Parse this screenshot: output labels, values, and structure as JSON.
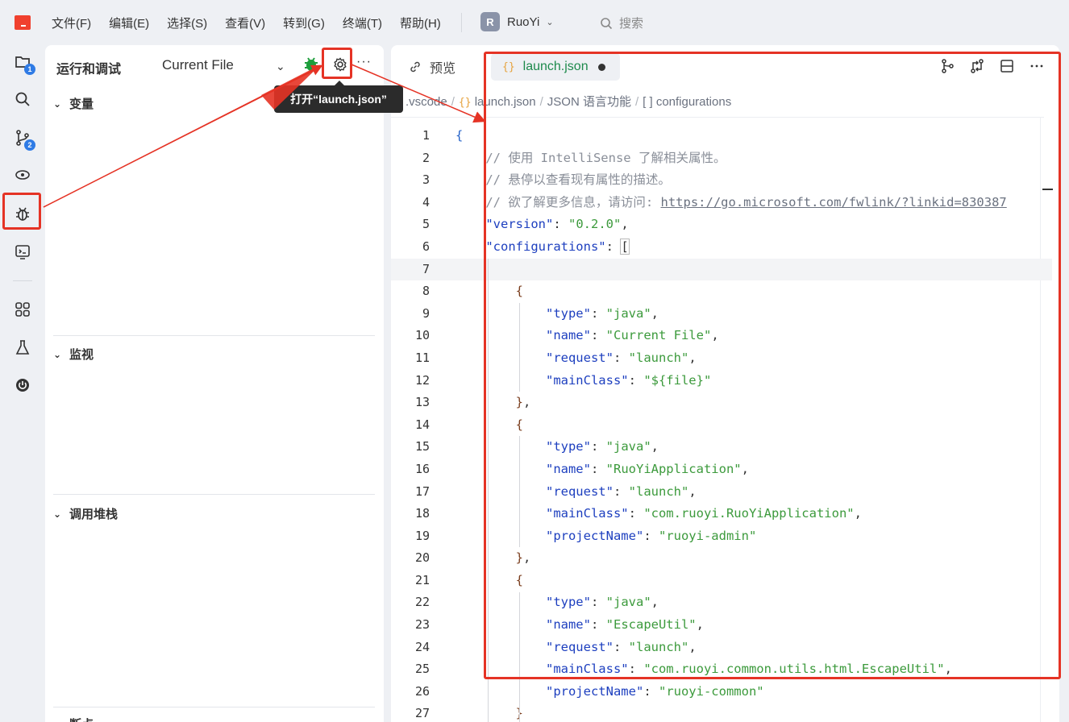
{
  "menu": [
    "文件(F)",
    "编辑(E)",
    "选择(S)",
    "查看(V)",
    "转到(G)",
    "终端(T)",
    "帮助(H)"
  ],
  "workspace": {
    "initial": "R",
    "name": "RuoYi"
  },
  "search": {
    "label": "搜索"
  },
  "activity": {
    "explorer_badge": "1",
    "scm_badge": "2"
  },
  "side": {
    "title": "运行和调试",
    "config": "Current File",
    "more": "···",
    "sections": [
      "变量",
      "监视",
      "调用堆栈",
      "断点"
    ],
    "tooltip": "打开“launch.json”"
  },
  "editor": {
    "tabs": {
      "preview": "预览",
      "active": "launch.json",
      "braces": "{}"
    },
    "breadcrumb": {
      "folder": ".vscode",
      "file": "launch.json",
      "lang": "JSON 语言功能",
      "node": "configurations",
      "node_icon": "[ ]"
    },
    "actions": [
      "source-control-icon",
      "compare-icon",
      "split-editor-icon",
      "more-icon"
    ],
    "lines": [
      {
        "n": "1",
        "html": "<span class='tok-brace'>{</span>"
      },
      {
        "n": "2",
        "html": "    <span class='tok-comment'>// 使用 IntelliSense 了解相关属性。</span>"
      },
      {
        "n": "3",
        "html": "    <span class='tok-comment'>// 悬停以查看现有属性的描述。</span>"
      },
      {
        "n": "4",
        "html": "    <span class='tok-comment'>// 欲了解更多信息，请访问: </span><span class='tok-link'>https://go.microsoft.com/fwlink/?linkid=830387</span>"
      },
      {
        "n": "5",
        "html": "    <span class='tok-key'>\"version\"</span><span class='tok-punc'>: </span><span class='tok-str'>\"0.2.0\"</span><span class='tok-punc'>,</span>"
      },
      {
        "n": "6",
        "html": "    <span class='tok-key'>\"configurations\"</span><span class='tok-punc'>: </span><span class='tok-bracket'>[</span>"
      },
      {
        "n": "7",
        "html": ""
      },
      {
        "n": "8",
        "html": "        <span class='tok-brace2'>{</span>"
      },
      {
        "n": "9",
        "html": "            <span class='tok-key'>\"type\"</span><span class='tok-punc'>: </span><span class='tok-str'>\"java\"</span><span class='tok-punc'>,</span>"
      },
      {
        "n": "10",
        "html": "            <span class='tok-key'>\"name\"</span><span class='tok-punc'>: </span><span class='tok-str'>\"Current File\"</span><span class='tok-punc'>,</span>"
      },
      {
        "n": "11",
        "html": "            <span class='tok-key'>\"request\"</span><span class='tok-punc'>: </span><span class='tok-str'>\"launch\"</span><span class='tok-punc'>,</span>"
      },
      {
        "n": "12",
        "html": "            <span class='tok-key'>\"mainClass\"</span><span class='tok-punc'>: </span><span class='tok-str'>\"${file}\"</span>"
      },
      {
        "n": "13",
        "html": "        <span class='tok-brace2'>}</span><span class='tok-punc'>,</span>"
      },
      {
        "n": "14",
        "html": "        <span class='tok-brace2'>{</span>"
      },
      {
        "n": "15",
        "html": "            <span class='tok-key'>\"type\"</span><span class='tok-punc'>: </span><span class='tok-str'>\"java\"</span><span class='tok-punc'>,</span>"
      },
      {
        "n": "16",
        "html": "            <span class='tok-key'>\"name\"</span><span class='tok-punc'>: </span><span class='tok-str'>\"RuoYiApplication\"</span><span class='tok-punc'>,</span>"
      },
      {
        "n": "17",
        "html": "            <span class='tok-key'>\"request\"</span><span class='tok-punc'>: </span><span class='tok-str'>\"launch\"</span><span class='tok-punc'>,</span>"
      },
      {
        "n": "18",
        "html": "            <span class='tok-key'>\"mainClass\"</span><span class='tok-punc'>: </span><span class='tok-str'>\"com.ruoyi.RuoYiApplication\"</span><span class='tok-punc'>,</span>"
      },
      {
        "n": "19",
        "html": "            <span class='tok-key'>\"projectName\"</span><span class='tok-punc'>: </span><span class='tok-str'>\"ruoyi-admin\"</span>"
      },
      {
        "n": "20",
        "html": "        <span class='tok-brace2'>}</span><span class='tok-punc'>,</span>"
      },
      {
        "n": "21",
        "html": "        <span class='tok-brace2'>{</span>"
      },
      {
        "n": "22",
        "html": "            <span class='tok-key'>\"type\"</span><span class='tok-punc'>: </span><span class='tok-str'>\"java\"</span><span class='tok-punc'>,</span>"
      },
      {
        "n": "23",
        "html": "            <span class='tok-key'>\"name\"</span><span class='tok-punc'>: </span><span class='tok-str'>\"EscapeUtil\"</span><span class='tok-punc'>,</span>"
      },
      {
        "n": "24",
        "html": "            <span class='tok-key'>\"request\"</span><span class='tok-punc'>: </span><span class='tok-str'>\"launch\"</span><span class='tok-punc'>,</span>"
      },
      {
        "n": "25",
        "html": "            <span class='tok-key'>\"mainClass\"</span><span class='tok-punc'>: </span><span class='tok-str'>\"com.ruoyi.common.utils.html.EscapeUtil\"</span><span class='tok-punc'>,</span>"
      },
      {
        "n": "26",
        "html": "            <span class='tok-key'>\"projectName\"</span><span class='tok-punc'>: </span><span class='tok-str'>\"ruoyi-common\"</span>"
      },
      {
        "n": "27",
        "html": "        <span class='tok-brace2'>}</span>"
      }
    ],
    "current_line": "7"
  },
  "colors": {
    "annotation": "#e53325",
    "accent_green": "#1e8a4c",
    "key_blue": "#1d3fbf",
    "string_green": "#3c9a3c"
  }
}
